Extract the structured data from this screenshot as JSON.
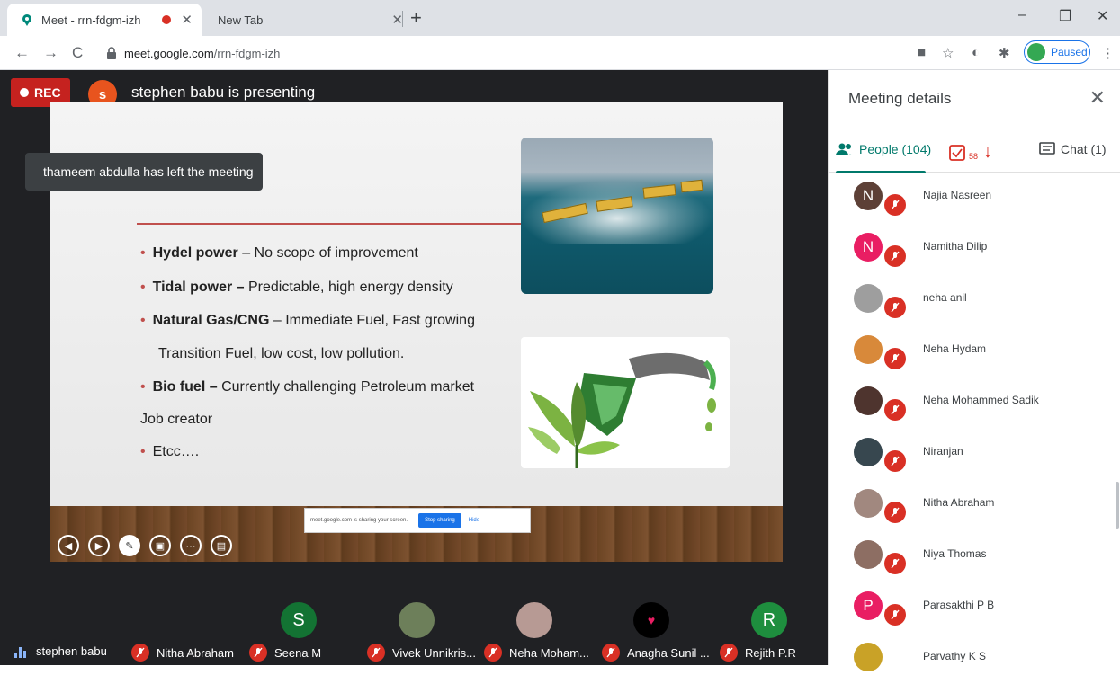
{
  "browser": {
    "tabs": [
      {
        "title": "Meet - rrn-fdgm-izh",
        "active": true
      },
      {
        "title": "New Tab",
        "active": false
      }
    ],
    "url_host": "meet.google.com",
    "url_path": "/rrn-fdgm-izh",
    "profile_label": "Paused",
    "colors": {
      "tab_strip": "#dee1e6",
      "accent": "#1a73e8"
    }
  },
  "meet": {
    "rec_label": "REC",
    "presenter_initial": "s",
    "presenting_text": "stephen babu is presenting",
    "slide": {
      "bullets": [
        {
          "bold": "Hydel power",
          "rest": " – No scope of improvement",
          "marker": "•"
        },
        {
          "bold": "Tidal power –",
          "rest": " Predictable, high energy density",
          "marker": "•"
        },
        {
          "bold": "Natural Gas/CNG",
          "rest": " – Immediate Fuel, Fast growing",
          "marker": "•"
        },
        {
          "bold": "",
          "rest": "Transition Fuel, low cost, low pollution.",
          "marker": ""
        },
        {
          "bold": "Bio fuel –",
          "rest": " Currently challenging Petroleum market",
          "marker": "•"
        },
        {
          "bold": "",
          "rest": "Job creator",
          "marker": ""
        },
        {
          "bold": "",
          "rest": "Etcc….",
          "marker": "•"
        }
      ]
    },
    "share_banner": {
      "text": "meet.google.com is sharing your screen.",
      "stop_label": "Stop sharing",
      "hide_label": "Hide"
    },
    "toast": "thameem abdulla has left the meeting",
    "tiles": [
      {
        "initial": "S",
        "color": "#137333"
      },
      {
        "initial": "R",
        "color": "#1e8e3e"
      }
    ],
    "participants_strip": [
      {
        "name": "stephen babu",
        "muted": false
      },
      {
        "name": "Nitha Abraham",
        "muted": true
      },
      {
        "name": "Seena M",
        "muted": true
      },
      {
        "name": "Vivek Unnikris...",
        "muted": true
      },
      {
        "name": "Neha Moham...",
        "muted": true
      },
      {
        "name": "Anagha Sunil ...",
        "muted": true
      },
      {
        "name": "Rejith P.R",
        "muted": true
      }
    ]
  },
  "panel": {
    "title": "Meeting details",
    "tabs": {
      "people": "People (104)",
      "tasks_count": "58",
      "chat": "Chat (1)"
    },
    "people": [
      {
        "name": "Najia Nasreen",
        "initial": "N",
        "color": "#5d4037"
      },
      {
        "name": "Namitha Dilip",
        "initial": "N",
        "color": "#e91e63"
      },
      {
        "name": "neha anil",
        "initial": "",
        "color": "#9e9e9e"
      },
      {
        "name": "Neha Hydam",
        "initial": "",
        "color": "#d8893a"
      },
      {
        "name": "Neha Mohammed Sadik",
        "initial": "",
        "color": "#4e342e"
      },
      {
        "name": "Niranjan",
        "initial": "",
        "color": "#37474f"
      },
      {
        "name": "Nitha Abraham",
        "initial": "",
        "color": "#a1887f"
      },
      {
        "name": "Niya Thomas",
        "initial": "",
        "color": "#8d6e63"
      },
      {
        "name": "Parasakthi P B",
        "initial": "P",
        "color": "#e91e63"
      },
      {
        "name": "Parvathy K S",
        "initial": "",
        "color": "#c9a227"
      }
    ]
  }
}
